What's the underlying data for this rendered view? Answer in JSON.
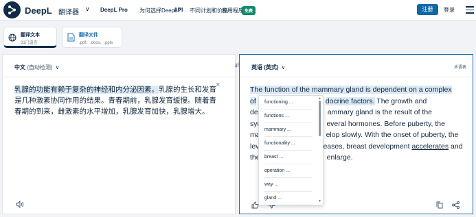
{
  "header": {
    "brand": "DeepL",
    "brand_sub": "翻译器",
    "nav": [
      "DeepL Pro",
      "为何选择DeepL?",
      "API",
      "不同计划和价格",
      "应用程序"
    ],
    "badge": "免费",
    "signup": "注册",
    "login": "登录"
  },
  "tabs": [
    {
      "title": "翻译文本",
      "subtitle": "31门语言"
    },
    {
      "title": "翻译文件",
      "subtitle": ".pdf、.docx、.pptx"
    }
  ],
  "source": {
    "language": "中文",
    "detect": "(自动检测)",
    "text_highlight": "乳腺的功能有赖于复杂的神经和内分泌因素。",
    "text_rest": "乳腺的生长和发育是几种激素协同作用的结果。青春期前，乳腺发育缓慢。随着青春期的到来，雌激素的水平增加，乳腺发育加快，乳腺增大。"
  },
  "target": {
    "language": "英语 (英式)",
    "glossary": "术语表",
    "line1": "The function of the mammary gland is dependent on a complex",
    "line2a": "of",
    "line2b": "docrine factors.",
    "line2c": " The growth and",
    "line3a": "de",
    "line3b": "ammary gland is the result of the",
    "line4a": "syn",
    "line4b": "everal hormones. Before puberty, the",
    "line5a": "ma",
    "line5b": "elop slowly. With the onset of puberty, the",
    "line6a": "lev",
    "line6b": "eases, breast development ",
    "line6u": "accelerates",
    "line6c": " and",
    "line7a": "the",
    "line7b": "enlarge."
  },
  "dropdown": [
    "functioning ...",
    "functions ...",
    "mammary ...",
    "functionality ...",
    "breast ...",
    "operation ...",
    "way ...",
    "gland ..."
  ],
  "icons": {
    "logo": "deepl-logo-icon",
    "menu": "hamburger-menu-icon",
    "globe": "globe-icon",
    "file": "document-icon",
    "swap": "swap-icon",
    "clear": "close-icon",
    "speaker": "speaker-icon",
    "like": "thumbs-up-icon",
    "dislike": "thumbs-down-icon",
    "copy": "copy-icon",
    "share": "share-icon"
  }
}
